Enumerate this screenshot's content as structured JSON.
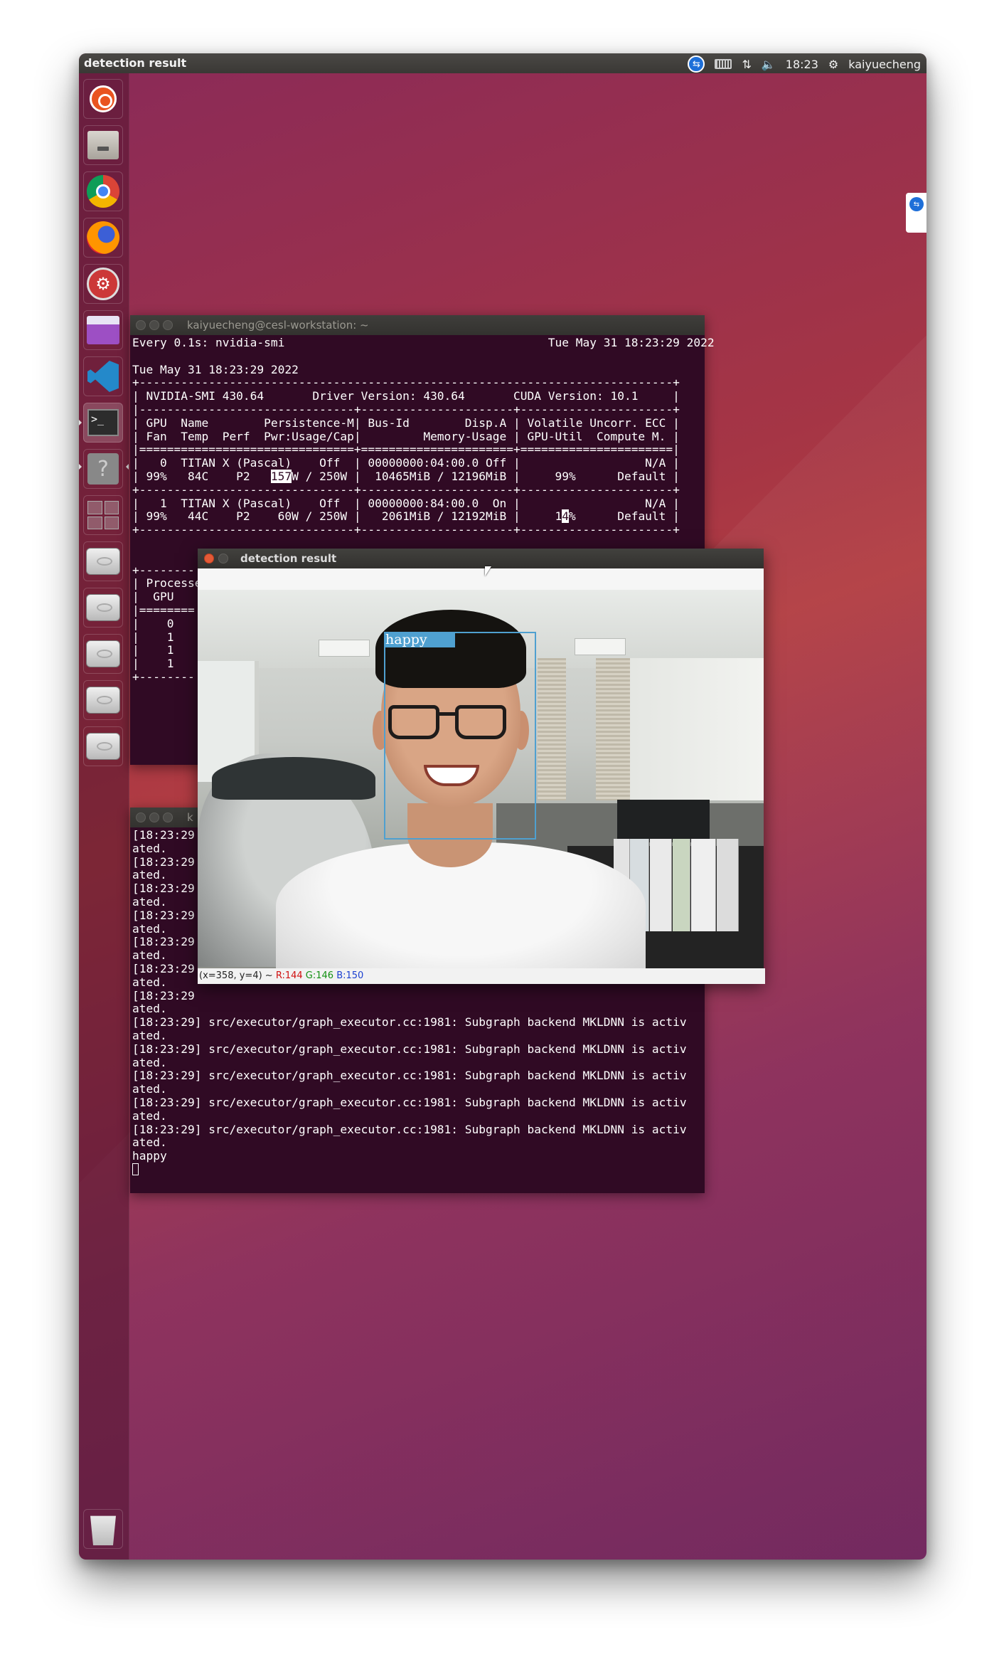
{
  "top_panel": {
    "title": "detection result",
    "time": "18:23",
    "user": "kaiyuecheng",
    "icons": [
      "teamviewer-icon",
      "keyboard-icon",
      "network-updown-icon",
      "volume-muted-icon",
      "gear-icon"
    ]
  },
  "launcher": {
    "items": [
      "Ubuntu dash",
      "Files",
      "Google Chrome",
      "Firefox",
      "System settings",
      "Software store",
      "Visual Studio Code",
      "Terminal",
      "Help",
      "Workspace switcher",
      "Drive",
      "Drive",
      "Drive",
      "Drive",
      "Drive",
      "Trash"
    ]
  },
  "terminal1": {
    "title": "kaiyuecheng@cesl-workstation: ~",
    "lines": [
      "Every 0.1s: nvidia-smi                                      Tue May 31 18:23:29 2022",
      "",
      "Tue May 31 18:23:29 2022",
      "+-----------------------------------------------------------------------------+",
      "| NVIDIA-SMI 430.64       Driver Version: 430.64       CUDA Version: 10.1     |",
      "|-------------------------------+----------------------+----------------------+",
      "| GPU  Name        Persistence-M| Bus-Id        Disp.A | Volatile Uncorr. ECC |",
      "| Fan  Temp  Perf  Pwr:Usage/Cap|         Memory-Usage | GPU-Util  Compute M. |",
      "|===============================+======================+======================|",
      "|   0  TITAN X (Pascal)    Off  | 00000000:04:00.0 Off |                  N/A |",
      "| 99%   84C    P2   157W / 250W |  10465MiB / 12196MiB |     99%      Default |",
      "+-------------------------------+----------------------+----------------------+",
      "|   1  TITAN X (Pascal)    Off  | 00000000:84:00.0  On |                  N/A |",
      "| 99%   44C    P2    60W / 250W |   2061MiB / 12192MiB |     14%      Default |",
      "+-------------------------------+----------------------+----------------------+",
      "",
      "",
      "+--------",
      "| Processe",
      "|  GPU    ",
      "|========",
      "|    0    ",
      "|    1    ",
      "|    1    ",
      "|    1    ",
      "+--------"
    ]
  },
  "terminal2": {
    "title": "k",
    "lines": [
      "[18:23:29",
      "ated.",
      "[18:23:29",
      "ated.",
      "[18:23:29",
      "ated.",
      "[18:23:29",
      "ated.",
      "[18:23:29",
      "ated.",
      "[18:23:29",
      "ated.",
      "[18:23:29",
      "ated.",
      "[18:23:29] src/executor/graph_executor.cc:1981: Subgraph backend MKLDNN is activ",
      "ated.",
      "[18:23:29] src/executor/graph_executor.cc:1981: Subgraph backend MKLDNN is activ",
      "ated.",
      "[18:23:29] src/executor/graph_executor.cc:1981: Subgraph backend MKLDNN is activ",
      "ated.",
      "[18:23:29] src/executor/graph_executor.cc:1981: Subgraph backend MKLDNN is activ",
      "ated.",
      "[18:23:29] src/executor/graph_executor.cc:1981: Subgraph backend MKLDNN is activ",
      "ated.",
      "happy"
    ]
  },
  "detection_window": {
    "title": "detection result",
    "label": "happy",
    "status_prefix": "(x=358, y=4) ~ ",
    "status_r": "R:144",
    "status_g": "G:146",
    "status_b": "B:150",
    "box_color": "#4fa0d0"
  }
}
